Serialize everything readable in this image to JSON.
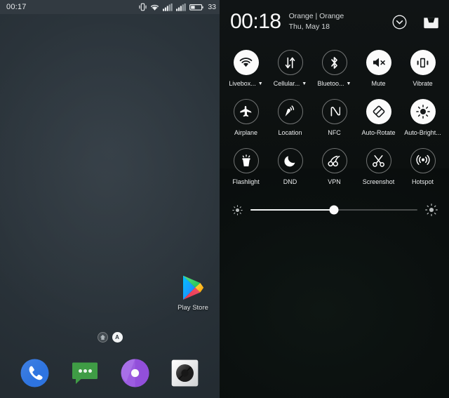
{
  "home": {
    "statusbar": {
      "time": "00:17",
      "battery_percent": "33",
      "icons": [
        "vibrate-icon",
        "wifi-icon",
        "signal-sim1-icon",
        "signal-sim2-icon",
        "battery-icon"
      ]
    },
    "apps": [
      {
        "label": "Play Store",
        "icon": "play-store-icon"
      }
    ],
    "page_indicators": [
      {
        "name": "home-page-indicator",
        "glyph": "home-icon",
        "active": false
      },
      {
        "name": "app-page-indicator",
        "glyph": "A",
        "active": true
      }
    ],
    "dock": [
      {
        "label": "Phone",
        "icon": "phone-icon"
      },
      {
        "label": "Messaging",
        "icon": "messaging-icon"
      },
      {
        "label": "Browser",
        "icon": "browser-icon"
      },
      {
        "label": "Camera",
        "icon": "camera-icon"
      }
    ]
  },
  "quick_settings": {
    "clock": "00:18",
    "carrier": "Orange | Orange",
    "date": "Thu, May 18",
    "header_actions": [
      {
        "name": "expand-button",
        "icon": "chevron-down-circle-icon"
      },
      {
        "name": "inbox-button",
        "icon": "inbox-tray-icon"
      }
    ],
    "rows": [
      [
        {
          "label": "Livebox...",
          "icon": "wifi-icon",
          "active": true,
          "has_caret": true
        },
        {
          "label": "Cellular...",
          "icon": "cellular-icon",
          "active": false,
          "has_caret": true
        },
        {
          "label": "Bluetoo...",
          "icon": "bluetooth-icon",
          "active": false,
          "has_caret": true
        },
        {
          "label": "Mute",
          "icon": "mute-icon",
          "active": true,
          "has_caret": false
        },
        {
          "label": "Vibrate",
          "icon": "vibrate-icon",
          "active": true,
          "has_caret": false
        }
      ],
      [
        {
          "label": "Airplane",
          "icon": "airplane-icon",
          "active": false,
          "has_caret": false
        },
        {
          "label": "Location",
          "icon": "location-icon",
          "active": false,
          "has_caret": false
        },
        {
          "label": "NFC",
          "icon": "nfc-icon",
          "active": false,
          "has_caret": false
        },
        {
          "label": "Auto-Rotate",
          "icon": "auto-rotate-icon",
          "active": true,
          "has_caret": false
        },
        {
          "label": "Auto-Bright...",
          "icon": "auto-brightness-icon",
          "active": true,
          "has_caret": false
        }
      ],
      [
        {
          "label": "Flashlight",
          "icon": "flashlight-icon",
          "active": false,
          "has_caret": false
        },
        {
          "label": "DND",
          "icon": "dnd-moon-icon",
          "active": false,
          "has_caret": false
        },
        {
          "label": "VPN",
          "icon": "vpn-icon",
          "active": false,
          "has_caret": false
        },
        {
          "label": "Screenshot",
          "icon": "scissors-icon",
          "active": false,
          "has_caret": false
        },
        {
          "label": "Hotspot",
          "icon": "hotspot-icon",
          "active": false,
          "has_caret": false
        }
      ]
    ],
    "brightness": {
      "value_percent": 50,
      "low_icon": "brightness-low-icon",
      "high_icon": "brightness-high-icon"
    }
  },
  "colors": {
    "home_wallpaper": "#2b343b",
    "statusbar_bg": "#323a41",
    "qs_bg": "#0a0d0d",
    "tile_on": "#fbfbfb",
    "accent_white": "#ffffff"
  }
}
